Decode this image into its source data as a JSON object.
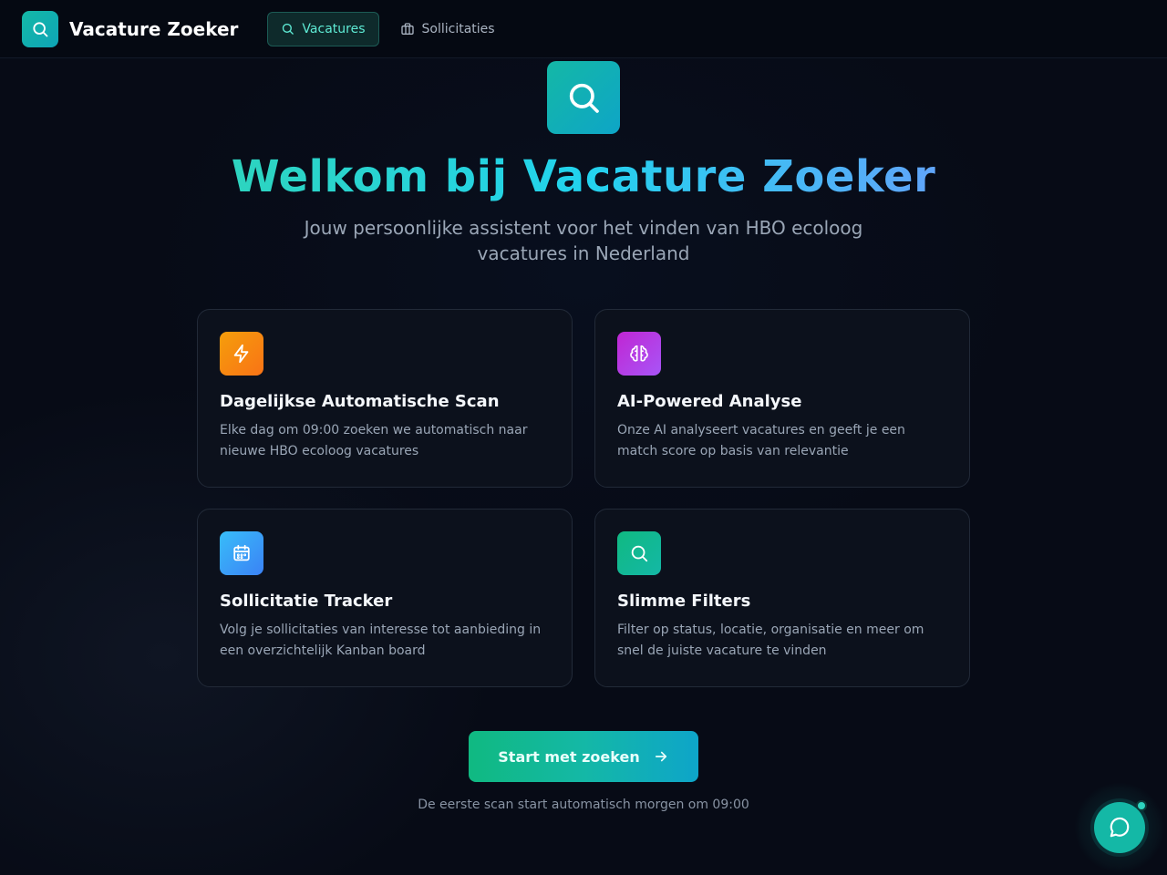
{
  "app": {
    "brand": "Vacature Zoeker"
  },
  "nav": {
    "items": [
      {
        "label": "Vacatures",
        "icon": "search-icon",
        "active": true
      },
      {
        "label": "Sollicitaties",
        "icon": "briefcase-icon",
        "active": false
      }
    ]
  },
  "hero": {
    "title": "Welkom bij Vacature Zoeker",
    "subtitle": "Jouw persoonlijke assistent voor het vinden van HBO ecoloog vacatures in Nederland"
  },
  "features": [
    {
      "title": "Dagelijkse Automatische Scan",
      "description": "Elke dag om 09:00 zoeken we automatisch naar nieuwe HBO ecoloog vacatures",
      "icon": "lightning-icon",
      "color": "#f97316"
    },
    {
      "title": "AI-Powered Analyse",
      "description": "Onze AI analyseert vacatures en geeft je een match score op basis van relevantie",
      "icon": "brain-icon",
      "color": "#c026d3"
    },
    {
      "title": "Sollicitatie Tracker",
      "description": "Volg je sollicitaties van interesse tot aanbieding in een overzichtelijk Kanban board",
      "icon": "calendar-icon",
      "color": "#0ea5e9"
    },
    {
      "title": "Slimme Filters",
      "description": "Filter op status, locatie, organisatie en meer om snel de juiste vacature te vinden",
      "icon": "search-icon",
      "color": "#10b981"
    }
  ],
  "cta": {
    "label": "Start met zoeken",
    "note": "De eerste scan start automatisch morgen om 09:00"
  },
  "colors": {
    "accent": "#14b8a6",
    "background": "#070b16",
    "card": "#0c111c"
  }
}
